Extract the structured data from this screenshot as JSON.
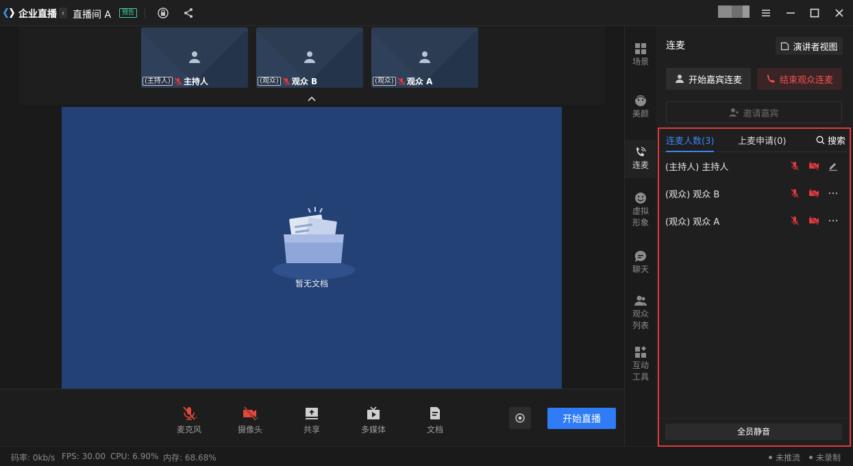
{
  "titlebar": {
    "app_name": "企业直播",
    "back_glyph": "‹",
    "room_name": "直播间 A",
    "preview_badge": "预告"
  },
  "thumbnails": [
    {
      "tag": "(主持人)",
      "name": "主持人"
    },
    {
      "tag": "(观众)",
      "name": "观众 B"
    },
    {
      "tag": "(观众)",
      "name": "观众 A"
    }
  ],
  "stage": {
    "empty_text": "暂无文档",
    "background": "#234174"
  },
  "toolbar": {
    "tools": [
      {
        "label": "麦克风",
        "icon": "mic-off-icon"
      },
      {
        "label": "摄像头",
        "icon": "camera-off-icon"
      },
      {
        "label": "共享",
        "icon": "share-screen-icon"
      },
      {
        "label": "多媒体",
        "icon": "multimedia-icon"
      },
      {
        "label": "文档",
        "icon": "document-icon"
      }
    ],
    "start_label": "开始直播"
  },
  "status": {
    "bitrate": "码率: 0kb/s",
    "fps": "FPS: 30.00",
    "cpu": "CPU: 6.90%",
    "memory": "内存: 68.68%",
    "push": "未推流",
    "record": "未录制"
  },
  "nav": [
    {
      "label_1": "场景",
      "label_2": "",
      "icon": "scene-icon"
    },
    {
      "label_1": "美颜",
      "label_2": "",
      "icon": "beauty-icon"
    },
    {
      "label_1": "连麦",
      "label_2": "",
      "icon": "co-host-icon"
    },
    {
      "label_1": "虚拟",
      "label_2": "形象",
      "icon": "avatar-icon"
    },
    {
      "label_1": "聊天",
      "label_2": "",
      "icon": "chat-icon"
    },
    {
      "label_1": "观众",
      "label_2": "列表",
      "icon": "audience-icon"
    },
    {
      "label_1": "互动",
      "label_2": "工具",
      "icon": "interactive-tools-icon"
    }
  ],
  "panel": {
    "title": "连麦",
    "presenter_view": "演讲者视图",
    "start_guest": "开始嘉宾连麦",
    "end_audience": "结束观众连麦",
    "invite_guest": "邀请嘉宾",
    "tab_count": "连麦人数(3)",
    "tab_requests": "上麦申请(0)",
    "search": "搜索",
    "members": [
      {
        "name": "(主持人) 主持人",
        "action_icon": "edit-icon"
      },
      {
        "name": "(观众) 观众 B",
        "action_icon": "more-icon"
      },
      {
        "name": "(观众) 观众 A",
        "action_icon": "more-icon"
      }
    ],
    "mute_all": "全员静音"
  },
  "colors": {
    "accent": "#2f7cf6",
    "danger": "#e4393c",
    "badge": "#3fd2a8"
  }
}
